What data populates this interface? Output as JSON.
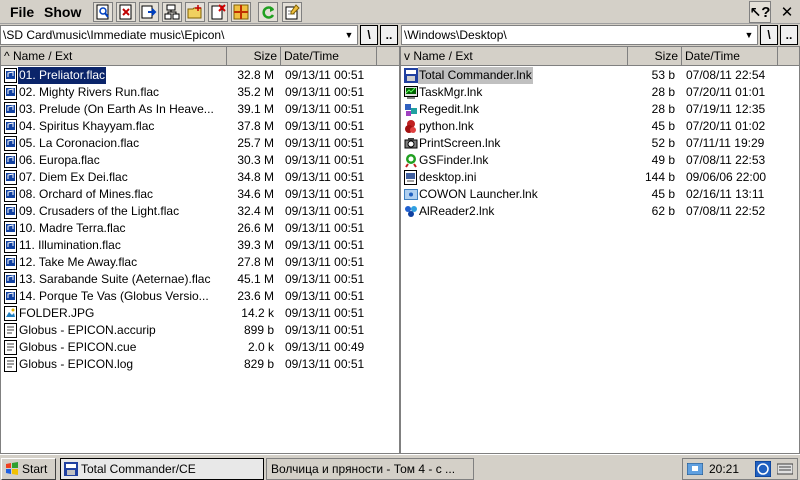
{
  "menu": {
    "file": "File",
    "show": "Show"
  },
  "toolbar": [
    "view-icon",
    "find-icon",
    "copy-icon",
    "tree-icon",
    "newfolder-icon",
    "delete-icon",
    "pack-icon",
    "refresh-icon",
    "properties-icon"
  ],
  "help_label": "?",
  "close_label": "✕",
  "left": {
    "path": "\\SD Card\\music\\Immediate music\\Epicon\\",
    "root_btn": "\\",
    "up_btn": "..",
    "headers": {
      "name": "^ Name / Ext",
      "size": "Size",
      "date": "Date/Time"
    },
    "files": [
      {
        "name": "01. Preliator.flac",
        "size": "32.8 M",
        "date": "09/13/11 00:51",
        "icon": "flac-file-icon"
      },
      {
        "name": "02. Mighty Rivers Run.flac",
        "size": "35.2 M",
        "date": "09/13/11 00:51",
        "icon": "flac-file-icon"
      },
      {
        "name": "03. Prelude (On Earth As In Heave...",
        "size": "39.1 M",
        "date": "09/13/11 00:51",
        "icon": "flac-file-icon"
      },
      {
        "name": "04. Spiritus Khayyam.flac",
        "size": "37.8 M",
        "date": "09/13/11 00:51",
        "icon": "flac-file-icon"
      },
      {
        "name": "05. La Coronacion.flac",
        "size": "25.7 M",
        "date": "09/13/11 00:51",
        "icon": "flac-file-icon"
      },
      {
        "name": "06. Europa.flac",
        "size": "30.3 M",
        "date": "09/13/11 00:51",
        "icon": "flac-file-icon"
      },
      {
        "name": "07. Diem Ex Dei.flac",
        "size": "34.8 M",
        "date": "09/13/11 00:51",
        "icon": "flac-file-icon"
      },
      {
        "name": "08. Orchard of Mines.flac",
        "size": "34.6 M",
        "date": "09/13/11 00:51",
        "icon": "flac-file-icon"
      },
      {
        "name": "09. Crusaders of the Light.flac",
        "size": "32.4 M",
        "date": "09/13/11 00:51",
        "icon": "flac-file-icon"
      },
      {
        "name": "10. Madre Terra.flac",
        "size": "26.6 M",
        "date": "09/13/11 00:51",
        "icon": "flac-file-icon"
      },
      {
        "name": "11. Illumination.flac",
        "size": "39.3 M",
        "date": "09/13/11 00:51",
        "icon": "flac-file-icon"
      },
      {
        "name": "12. Take Me Away.flac",
        "size": "27.8 M",
        "date": "09/13/11 00:51",
        "icon": "flac-file-icon"
      },
      {
        "name": "13. Sarabande Suite (Aeternae).flac",
        "size": "45.1 M",
        "date": "09/13/11 00:51",
        "icon": "flac-file-icon"
      },
      {
        "name": "14. Porque Te Vas (Globus Versio...",
        "size": "23.6 M",
        "date": "09/13/11 00:51",
        "icon": "flac-file-icon"
      },
      {
        "name": "FOLDER.JPG",
        "size": "14.2 k",
        "date": "09/13/11 00:51",
        "icon": "image-file-icon"
      },
      {
        "name": "Globus - EPICON.accurip",
        "size": "899 b",
        "date": "09/13/11 00:51",
        "icon": "generic-file-icon"
      },
      {
        "name": "Globus - EPICON.cue",
        "size": "2.0 k",
        "date": "09/13/11 00:49",
        "icon": "generic-file-icon"
      },
      {
        "name": "Globus - EPICON.log",
        "size": "829 b",
        "date": "09/13/11 00:51",
        "icon": "generic-file-icon"
      }
    ]
  },
  "right": {
    "path": "\\Windows\\Desktop\\",
    "root_btn": "\\",
    "up_btn": "..",
    "headers": {
      "name": "v Name / Ext",
      "size": "Size",
      "date": "Date/Time"
    },
    "files": [
      {
        "name": "Total Commander.lnk",
        "size": "53 b",
        "date": "07/08/11 22:54",
        "icon": "total-commander-icon"
      },
      {
        "name": "TaskMgr.lnk",
        "size": "28 b",
        "date": "07/20/11 01:01",
        "icon": "task-manager-icon"
      },
      {
        "name": "Regedit.lnk",
        "size": "28 b",
        "date": "07/19/11 12:35",
        "icon": "regedit-icon"
      },
      {
        "name": "python.lnk",
        "size": "45 b",
        "date": "07/20/11 01:02",
        "icon": "python-icon"
      },
      {
        "name": "PrintScreen.lnk",
        "size": "52 b",
        "date": "07/11/11 19:29",
        "icon": "printscreen-icon"
      },
      {
        "name": "GSFinder.lnk",
        "size": "49 b",
        "date": "07/08/11 22:53",
        "icon": "gsfinder-icon"
      },
      {
        "name": "desktop.ini",
        "size": "144 b",
        "date": "09/06/06 22:00",
        "icon": "ini-file-icon"
      },
      {
        "name": "COWON Launcher.lnk",
        "size": "45 b",
        "date": "02/16/11 13:11",
        "icon": "cowon-launcher-icon"
      },
      {
        "name": "AlReader2.lnk",
        "size": "62 b",
        "date": "07/08/11 22:52",
        "icon": "alreader-icon"
      }
    ]
  },
  "taskbar": {
    "start": "Start",
    "task1": "Total Commander/CE",
    "task2": "Волчица и пряности - Том 4 - с ...",
    "clock": "20:21"
  }
}
